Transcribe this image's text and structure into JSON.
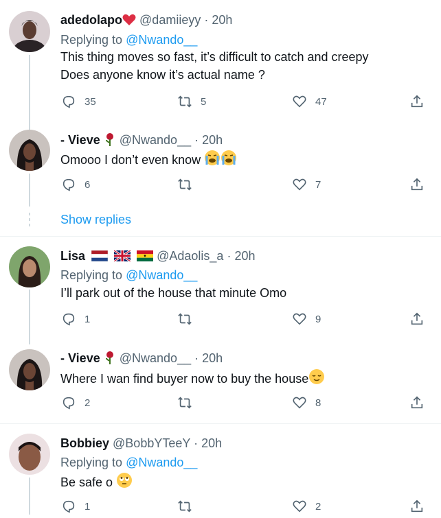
{
  "replies": [
    {
      "name": "adedolapo",
      "handle": "@damiieyy",
      "time": "20h",
      "replying_label": "Replying to",
      "replying_to": "@Nwando__",
      "lines": [
        "This thing moves so fast, it’s difficult to catch and creepy",
        "Does anyone know it’s actual name ?"
      ],
      "reply_count": "35",
      "retweet_count": "5",
      "like_count": "47"
    },
    {
      "name": "- Vieve",
      "handle": "@Nwando__",
      "time": "20h",
      "lines": [
        "Omooo I don’t even know"
      ],
      "reply_count": "6",
      "retweet_count": "",
      "like_count": "7"
    },
    {
      "name": "Lisa",
      "handle": "@Adaolis_a",
      "time": "20h",
      "replying_label": "Replying to",
      "replying_to": "@Nwando__",
      "lines": [
        "I’ll park out of the house that minute Omo"
      ],
      "reply_count": "1",
      "retweet_count": "",
      "like_count": "9"
    },
    {
      "name": "- Vieve",
      "handle": "@Nwando__",
      "time": "20h",
      "lines": [
        "Where I wan find buyer now to buy the house"
      ],
      "reply_count": "2",
      "retweet_count": "",
      "like_count": "8"
    },
    {
      "name": "Bobbiey",
      "handle": "@BobbYTeeY",
      "time": "20h",
      "replying_label": "Replying to",
      "replying_to": "@Nwando__",
      "lines": [
        "Be safe o"
      ],
      "reply_count": "1",
      "retweet_count": "",
      "like_count": "2"
    }
  ],
  "show_replies": "Show replies",
  "dot": "·",
  "colors": {
    "accent": "#1d9bf0",
    "muted": "#536471",
    "line": "#cfd9de"
  }
}
